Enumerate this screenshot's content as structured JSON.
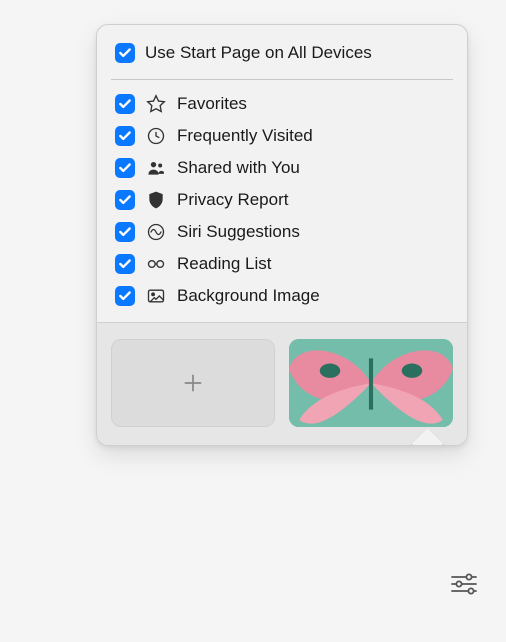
{
  "popover": {
    "header": {
      "label": "Use Start Page on All Devices",
      "checked": true
    },
    "items": [
      {
        "icon": "star-icon",
        "label": "Favorites",
        "checked": true
      },
      {
        "icon": "clock-icon",
        "label": "Frequently Visited",
        "checked": true
      },
      {
        "icon": "people-icon",
        "label": "Shared with You",
        "checked": true
      },
      {
        "icon": "shield-icon",
        "label": "Privacy Report",
        "checked": true
      },
      {
        "icon": "siri-icon",
        "label": "Siri Suggestions",
        "checked": true
      },
      {
        "icon": "glasses-icon",
        "label": "Reading List",
        "checked": true
      },
      {
        "icon": "image-icon",
        "label": "Background Image",
        "checked": true
      }
    ],
    "thumbs": {
      "add_label": "Add background image",
      "preview_label": "Butterfly wallpaper"
    }
  },
  "settings_button": {
    "label": "Customize Start Page"
  }
}
